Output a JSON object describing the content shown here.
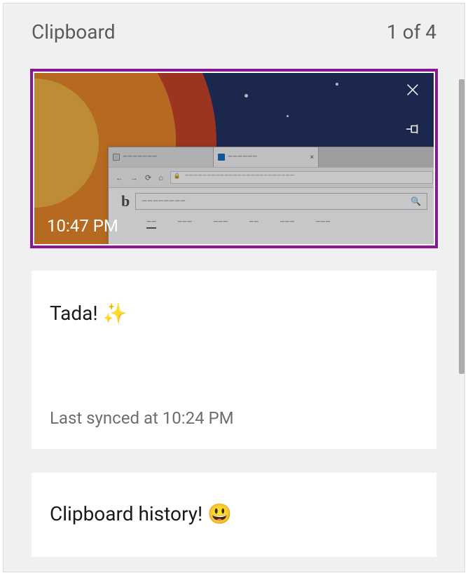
{
  "header": {
    "title": "Clipboard",
    "count": "1 of 4"
  },
  "items": [
    {
      "kind": "image",
      "timestamp": "10:47 PM",
      "selected": true
    },
    {
      "kind": "text",
      "content": "Tada! ✨",
      "sync": "Last synced at 10:24 PM"
    },
    {
      "kind": "text",
      "content": "Clipboard history! 😃"
    }
  ],
  "icons": {
    "delete": "close-icon",
    "pin": "pin-icon"
  }
}
